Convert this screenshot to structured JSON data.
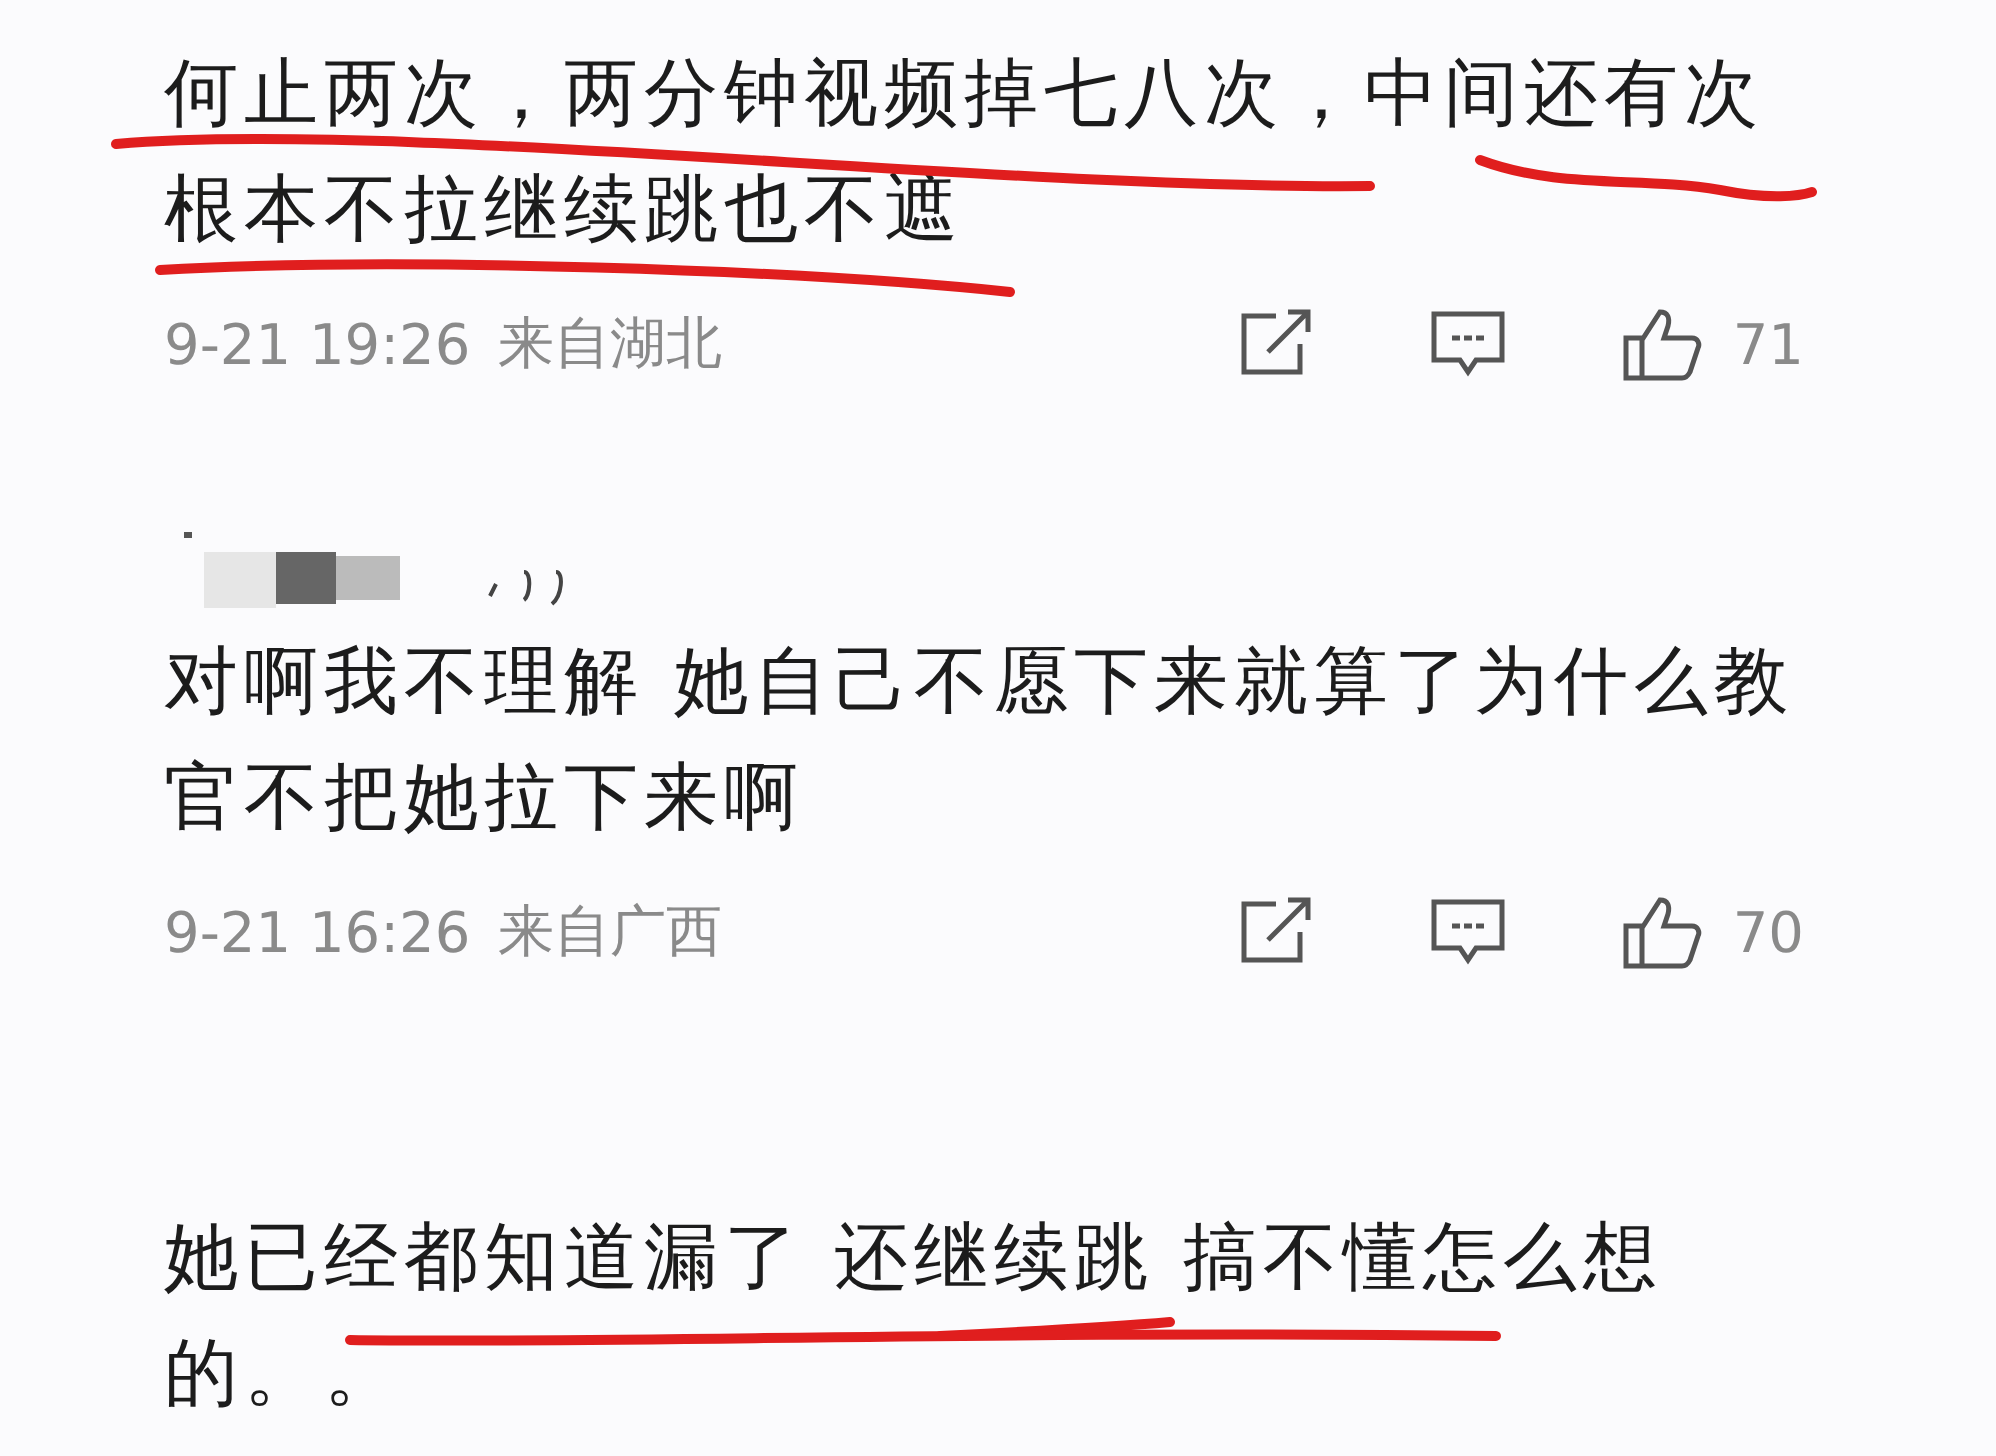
{
  "comments": [
    {
      "lines": [
        "何止两次，两分钟视频掉七八次，中间还有次",
        "根本不拉继续跳也不遮"
      ],
      "time": "9-21 19:26",
      "location": "来自湖北",
      "likes": "71"
    },
    {
      "author": {
        "kind": "blurred"
      },
      "lines": [
        "对啊我不理解 她自己不愿下来就算了为什么教",
        "官不把她拉下来啊"
      ],
      "time": "9-21 16:26",
      "location": "来自广西",
      "likes": "70"
    },
    {
      "lines": [
        "她已经都知道漏了 还继续跳 搞不懂怎么想",
        "的。。"
      ]
    }
  ]
}
